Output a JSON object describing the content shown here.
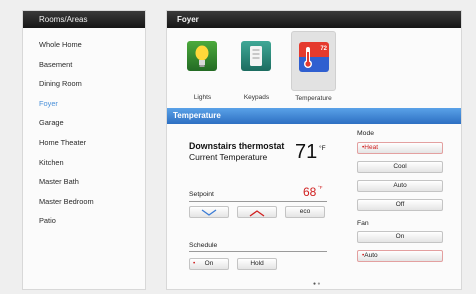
{
  "sidebar": {
    "header": "Rooms/Areas",
    "items": [
      {
        "label": "Whole Home"
      },
      {
        "label": "Basement"
      },
      {
        "label": "Dining Room"
      },
      {
        "label": "Foyer",
        "active": true
      },
      {
        "label": "Garage"
      },
      {
        "label": "Home Theater"
      },
      {
        "label": "Kitchen"
      },
      {
        "label": "Master Bath"
      },
      {
        "label": "Master Bedroom"
      },
      {
        "label": "Patio"
      }
    ]
  },
  "main": {
    "title": "Foyer",
    "tiles": [
      {
        "label": "Lights",
        "icon": "light-bulb-icon"
      },
      {
        "label": "Keypads",
        "icon": "keypad-icon"
      },
      {
        "label": "Temperature",
        "icon": "thermometer-icon",
        "badge": "72",
        "selected": true
      }
    ],
    "section_title": "Temperature",
    "thermostat": {
      "name": "Downstairs thermostat",
      "current_label": "Current Temperature",
      "current_value": "71",
      "unit": "°F"
    },
    "setpoint": {
      "label": "Setpoint",
      "value": "68",
      "unit": "°F",
      "eco_label": "eco"
    },
    "schedule": {
      "label": "Schedule",
      "on_label": "On",
      "hold_label": "Hold"
    },
    "mode": {
      "label": "Mode",
      "options": [
        "Heat",
        "Cool",
        "Auto",
        "Off"
      ],
      "selected": "Heat"
    },
    "fan": {
      "label": "Fan",
      "options": [
        "On",
        "Auto"
      ],
      "selected": "Auto"
    }
  },
  "colors": {
    "accent_blue": "#2d6fc2",
    "selected_red": "#d02020",
    "active_room": "#4a90d9"
  }
}
